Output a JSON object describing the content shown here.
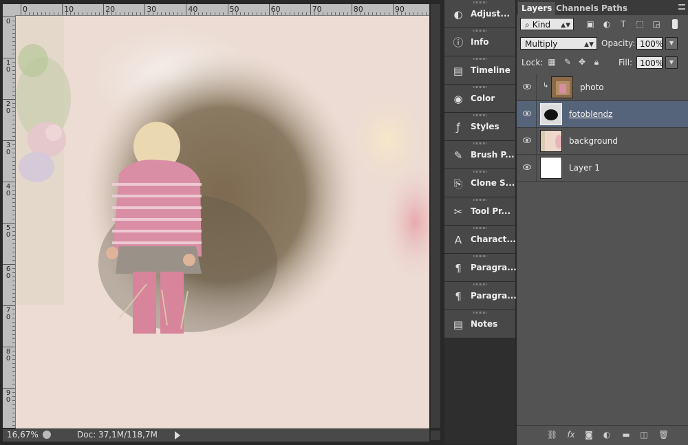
{
  "rulers": {
    "top_labels": [
      "0",
      "10",
      "20",
      "30",
      "40",
      "50",
      "60",
      "70",
      "80",
      "90"
    ],
    "left_labels": [
      "0",
      "10",
      "20",
      "30",
      "40",
      "50",
      "60",
      "70",
      "80",
      "90"
    ]
  },
  "status": {
    "zoom": "16,67%",
    "doc": "Doc: 37,1M/118,7M"
  },
  "dock": {
    "items": [
      {
        "label": "Adjust...",
        "icon": "adjustments-icon"
      },
      {
        "label": "Info",
        "icon": "info-icon"
      },
      {
        "label": "Timeline",
        "icon": "timeline-icon"
      },
      {
        "label": "Color",
        "icon": "color-palette-icon"
      },
      {
        "label": "Styles",
        "icon": "styles-fx-icon"
      },
      {
        "label": "Brush P...",
        "icon": "brush-presets-icon"
      },
      {
        "label": "Clone S...",
        "icon": "clone-source-icon"
      },
      {
        "label": "Tool Pr...",
        "icon": "tool-presets-icon"
      },
      {
        "label": "Charact...",
        "icon": "character-icon"
      },
      {
        "label": "Paragra...",
        "icon": "paragraph-icon"
      },
      {
        "label": "Paragra...",
        "icon": "paragraph-styles-icon"
      },
      {
        "label": "Notes",
        "icon": "notes-icon"
      }
    ]
  },
  "layers_panel": {
    "tabs": [
      "Layers",
      "Channels",
      "Paths"
    ],
    "filter": {
      "kind_label": "Kind"
    },
    "blend_mode": "Multiply",
    "opacity_label": "Opacity:",
    "opacity_value": "100%",
    "lock_label": "Lock:",
    "fill_label": "Fill:",
    "fill_value": "100%",
    "layers": [
      {
        "name": "photo",
        "selected": false,
        "clipped": true
      },
      {
        "name": "fotoblendz",
        "selected": true,
        "clipped": false
      },
      {
        "name": "background",
        "selected": false,
        "clipped": false
      },
      {
        "name": "Layer 1",
        "selected": false,
        "clipped": false
      }
    ]
  },
  "colors": {
    "panel_bg": "#535353",
    "selected_layer": "#56647a",
    "canvas_paper": "#ecdcd3"
  }
}
